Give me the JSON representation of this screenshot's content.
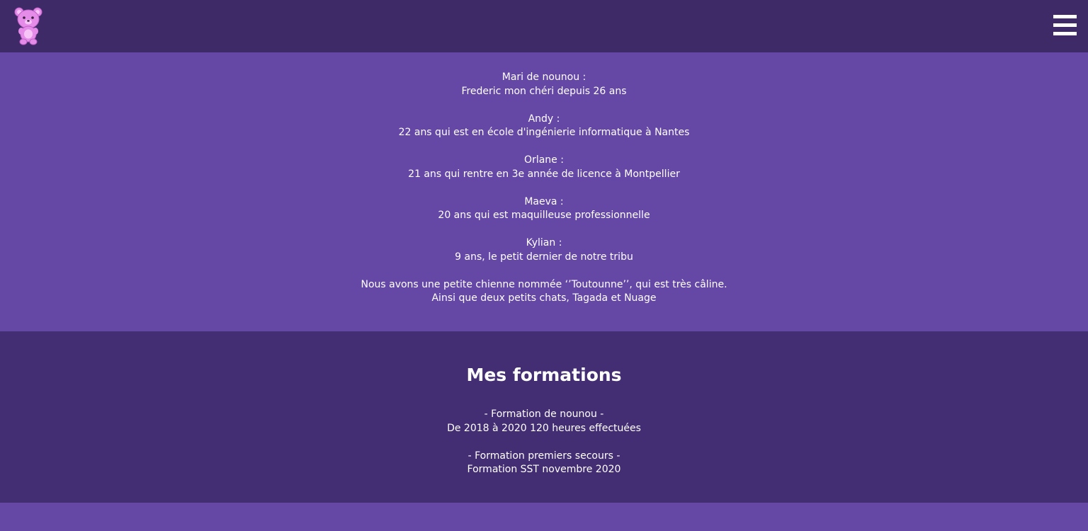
{
  "header": {
    "logo_icon": "pink-teddy-bear-icon",
    "menu_icon": "hamburger-menu-icon"
  },
  "family": {
    "members": [
      {
        "label": "Mari de nounou :",
        "detail": "Frederic mon chéri depuis 26 ans"
      },
      {
        "label": "Andy :",
        "detail": "22 ans qui est en école d'ingénierie informatique à Nantes"
      },
      {
        "label": "Orlane :",
        "detail": "21 ans qui rentre en 3e année de licence à Montpellier"
      },
      {
        "label": "Maeva :",
        "detail": "20 ans qui est maquilleuse professionnelle"
      },
      {
        "label": "Kylian :",
        "detail": "9 ans, le petit dernier de notre tribu"
      }
    ],
    "pets_line1": "Nous avons une petite chienne nommée ‘’Toutounne’’, qui est très câline.",
    "pets_line2": "Ainsi que deux petits chats, Tagada et Nuage"
  },
  "formations": {
    "title": "Mes formations",
    "items": [
      {
        "name": "- Formation de nounou -",
        "detail": "De 2018 à 2020 120 heures effectuées"
      },
      {
        "name": "- Formation premiers secours -",
        "detail": "Formation SST novembre 2020"
      }
    ]
  },
  "colors": {
    "header_bg": "#3d2a66",
    "section_light": "#6548a6",
    "section_dark": "#432e73",
    "logo_pink": "#e58be8"
  }
}
